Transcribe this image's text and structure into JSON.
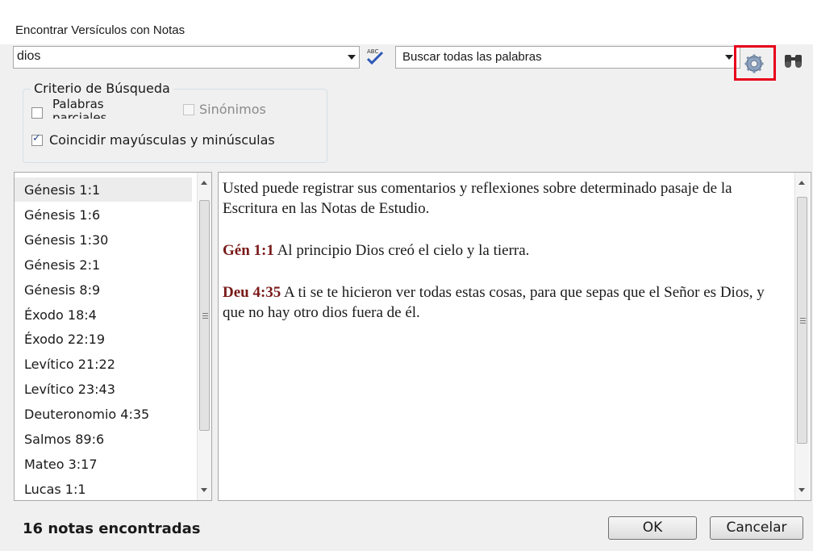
{
  "window": {
    "title": "Encontrar Versículos con Notas"
  },
  "search": {
    "value": "dios",
    "spell_icon": "spellcheck-icon"
  },
  "mode": {
    "value": "Buscar todas las palabras"
  },
  "toolbar": {
    "options_icon": "gear-icon",
    "find_icon": "binoculars-icon",
    "highlight_color": "#e8001a"
  },
  "criteria": {
    "title": "Criterio de Búsqueda",
    "partial_words": {
      "label": "Palabras parciales",
      "checked": false
    },
    "synonyms": {
      "label": "Sinónimos",
      "checked": false,
      "enabled": false
    },
    "match_case": {
      "label": "Coincidir mayúsculas y minúsculas",
      "checked": true
    }
  },
  "verses": [
    "Génesis 1:1",
    "Génesis 1:6",
    "Génesis 1:30",
    "Génesis 2:1",
    "Génesis 8:9",
    "Éxodo 18:4",
    "Éxodo 22:19",
    "Levítico 21:22",
    "Levítico 23:43",
    "Deuteronomio 4:35",
    "Salmos 89:6",
    "Mateo 3:17",
    "Lucas 1:1"
  ],
  "selected_verse": "Génesis 1:1",
  "note": {
    "intro": "Usted puede registrar sus comentarios y reflexiones sobre determinado pasaje de la Escritura en las Notas de Estudio.",
    "entries": [
      {
        "ref": "Gén 1:1",
        "text": "Al principio Dios creó el cielo y la tierra."
      },
      {
        "ref": "Deu 4:35",
        "text": "A ti se te hicieron ver todas estas cosas, para que sepas que el Señor es Dios, y que no hay otro dios fuera de él."
      }
    ]
  },
  "status": {
    "text": "16 notas encontradas"
  },
  "buttons": {
    "ok": "OK",
    "cancel": "Cancelar"
  }
}
